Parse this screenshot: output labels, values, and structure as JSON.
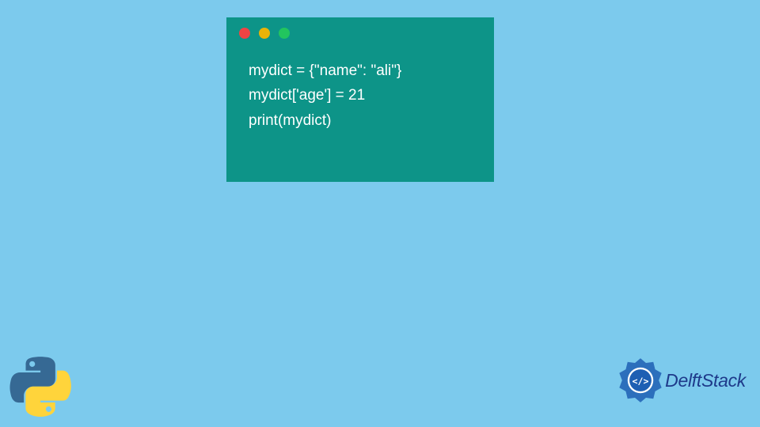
{
  "code": {
    "line1": "mydict = {\"name\": \"ali\"}",
    "line2": "mydict['age'] = 21",
    "line3": "print(mydict)"
  },
  "colors": {
    "background": "#7ccaed",
    "code_window": "#0d9488",
    "code_text": "#ffffff",
    "traffic_red": "#ef4444",
    "traffic_yellow": "#eab308",
    "traffic_green": "#22c55e",
    "python_blue": "#366994",
    "python_yellow": "#ffd43b",
    "delft_blue": "#1e3a8a"
  },
  "brand": {
    "name": "DelftStack"
  },
  "icons": {
    "python": "python-logo",
    "delft": "delftstack-logo"
  }
}
